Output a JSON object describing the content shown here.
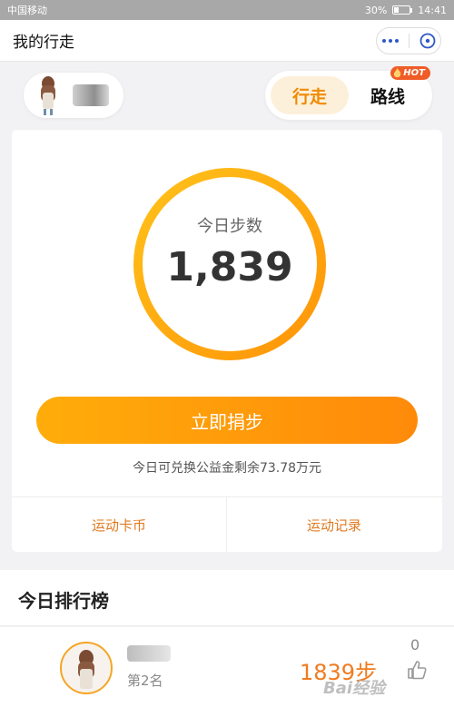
{
  "status_bar": {
    "carrier": "中国移动",
    "battery": "30%",
    "time": "14:41",
    "battery_level": 0.3
  },
  "header": {
    "title": "我的行走"
  },
  "tabs": [
    {
      "label": "行走",
      "active": true
    },
    {
      "label": "路线",
      "active": false,
      "badge": "HOT"
    }
  ],
  "steps_card": {
    "label": "今日步数",
    "steps": "1,839",
    "donate_button": "立即捐步",
    "remaining_text": "今日可兑换公益金剩余73.78万元",
    "links": [
      "运动卡币",
      "运动记录"
    ]
  },
  "leaderboard": {
    "title": "今日排行榜",
    "entries": [
      {
        "rank_text": "第2名",
        "steps": "1839步",
        "likes": "0"
      }
    ]
  },
  "watermark": "Bai经验",
  "colors": {
    "accent": "#ff9a0a",
    "link": "#e07a20",
    "tab_active_bg": "#fdf0db",
    "capsule_icon": "#2f59c6"
  },
  "icons": [
    "more-icon",
    "close-circle-icon",
    "like-icon",
    "flame-icon"
  ]
}
